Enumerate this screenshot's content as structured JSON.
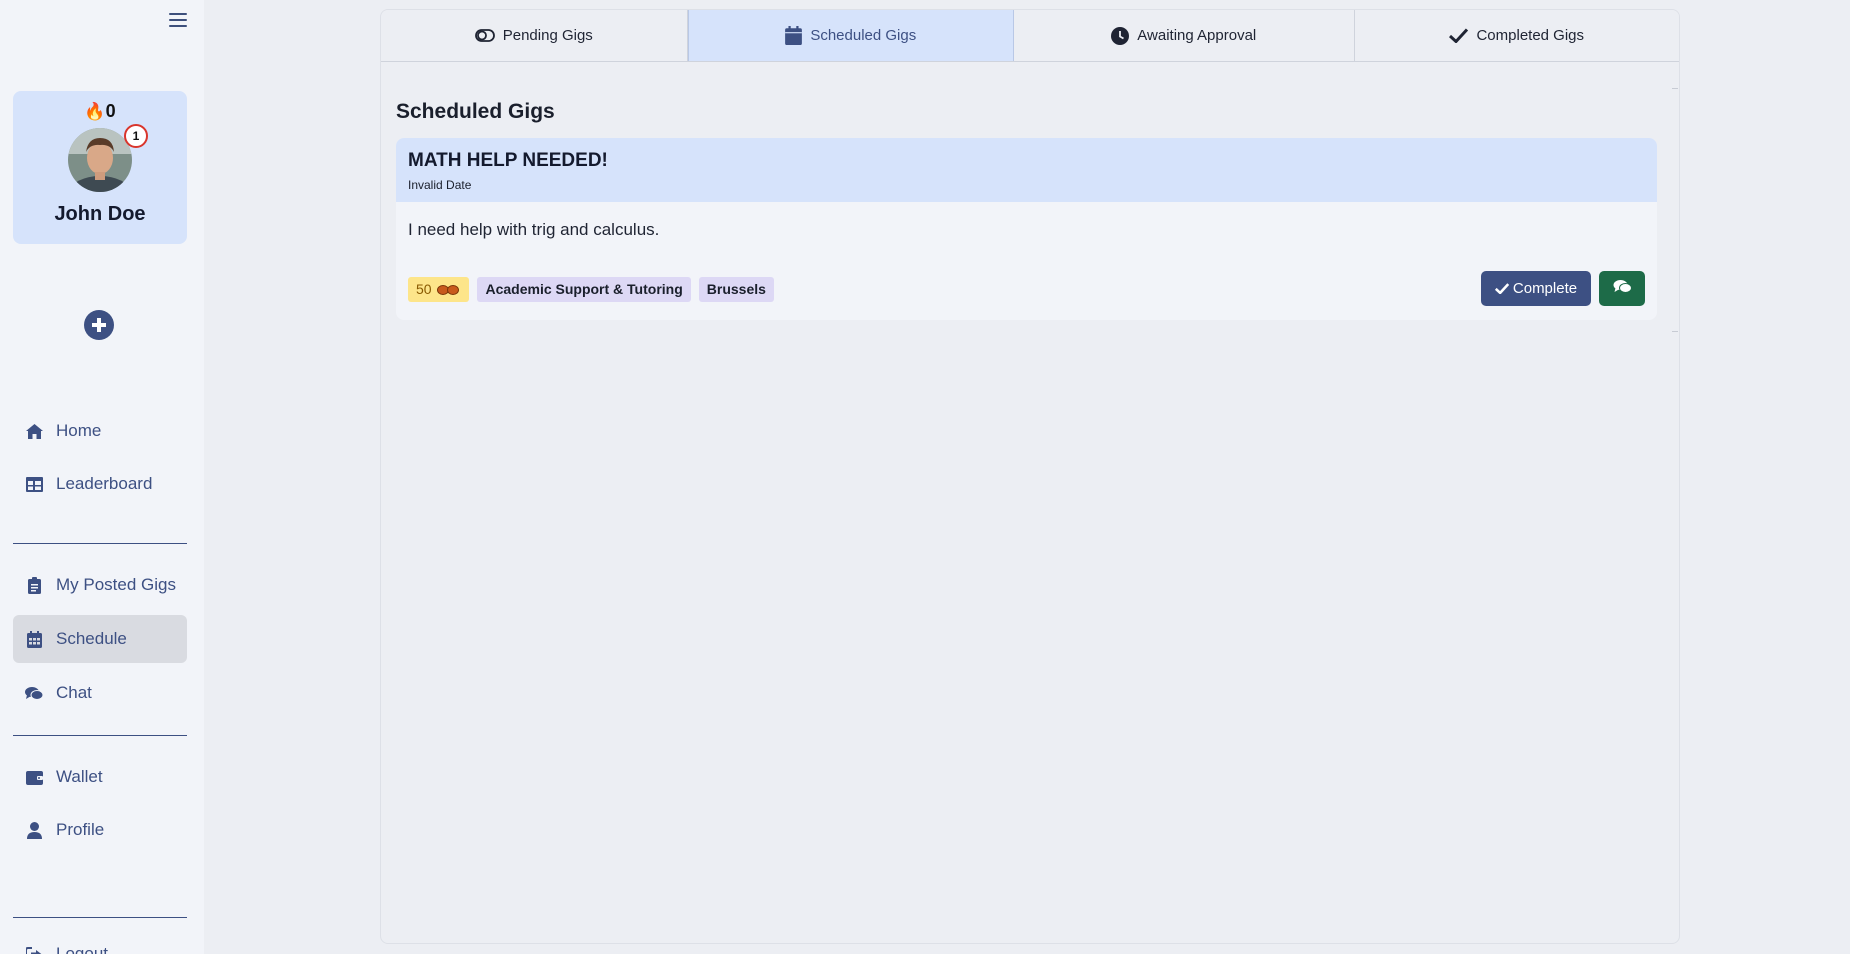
{
  "sidebar": {
    "streak": "0",
    "notification_count": "1",
    "user_name": "John Doe",
    "nav": [
      {
        "label": "Home",
        "icon": "home-icon"
      },
      {
        "label": "Leaderboard",
        "icon": "table-icon"
      },
      {
        "label": "My Posted Gigs",
        "icon": "clipboard-icon"
      },
      {
        "label": "Schedule",
        "icon": "calendar-icon",
        "active": true
      },
      {
        "label": "Chat",
        "icon": "comments-icon"
      },
      {
        "label": "Wallet",
        "icon": "wallet-icon"
      },
      {
        "label": "Profile",
        "icon": "user-icon"
      },
      {
        "label": "Logout",
        "icon": "logout-icon"
      }
    ]
  },
  "tabs": [
    {
      "label": "Pending Gigs",
      "icon": "toggle-icon"
    },
    {
      "label": "Scheduled Gigs",
      "icon": "calendar-icon",
      "active": true
    },
    {
      "label": "Awaiting Approval",
      "icon": "clock-icon"
    },
    {
      "label": "Completed Gigs",
      "icon": "check-icon"
    }
  ],
  "main": {
    "section_title": "Scheduled Gigs",
    "gig": {
      "title": "MATH HELP NEEDED!",
      "date": "Invalid Date",
      "description": "I need help with trig and calculus.",
      "price": "50",
      "category": "Academic Support & Tutoring",
      "location": "Brussels",
      "complete_label": "Complete"
    }
  },
  "colors": {
    "accent": "#3d5083",
    "active_bg": "#d6e3fb",
    "chat_button": "#1d6b48",
    "price_tag": "#fde58a",
    "tag": "#ddd8f5"
  }
}
